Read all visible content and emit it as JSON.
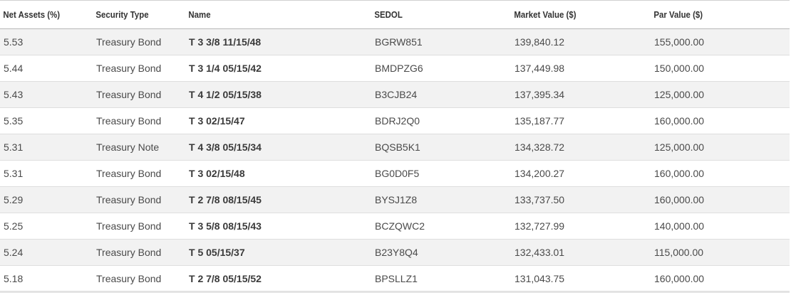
{
  "table": {
    "headers": {
      "net_assets": "Net Assets (%)",
      "security_type": "Security Type",
      "name": "Name",
      "sedol": "SEDOL",
      "market_value": "Market Value ($)",
      "par_value": "Par Value ($)"
    },
    "rows": [
      {
        "net_assets": "5.53",
        "security_type": "Treasury Bond",
        "name": "T 3 3/8 11/15/48",
        "sedol": "BGRW851",
        "market_value": "139,840.12",
        "par_value": "155,000.00"
      },
      {
        "net_assets": "5.44",
        "security_type": "Treasury Bond",
        "name": "T 3 1/4 05/15/42",
        "sedol": "BMDPZG6",
        "market_value": "137,449.98",
        "par_value": "150,000.00"
      },
      {
        "net_assets": "5.43",
        "security_type": "Treasury Bond",
        "name": "T 4 1/2 05/15/38",
        "sedol": "B3CJB24",
        "market_value": "137,395.34",
        "par_value": "125,000.00"
      },
      {
        "net_assets": "5.35",
        "security_type": "Treasury Bond",
        "name": "T 3 02/15/47",
        "sedol": "BDRJ2Q0",
        "market_value": "135,187.77",
        "par_value": "160,000.00"
      },
      {
        "net_assets": "5.31",
        "security_type": "Treasury Note",
        "name": "T 4 3/8 05/15/34",
        "sedol": "BQSB5K1",
        "market_value": "134,328.72",
        "par_value": "125,000.00"
      },
      {
        "net_assets": "5.31",
        "security_type": "Treasury Bond",
        "name": "T 3 02/15/48",
        "sedol": "BG0D0F5",
        "market_value": "134,200.27",
        "par_value": "160,000.00"
      },
      {
        "net_assets": "5.29",
        "security_type": "Treasury Bond",
        "name": "T 2 7/8 08/15/45",
        "sedol": "BYSJ1Z8",
        "market_value": "133,737.50",
        "par_value": "160,000.00"
      },
      {
        "net_assets": "5.25",
        "security_type": "Treasury Bond",
        "name": "T 3 5/8 08/15/43",
        "sedol": "BCZQWC2",
        "market_value": "132,727.99",
        "par_value": "140,000.00"
      },
      {
        "net_assets": "5.24",
        "security_type": "Treasury Bond",
        "name": "T 5 05/15/37",
        "sedol": "B23Y8Q4",
        "market_value": "132,433.01",
        "par_value": "115,000.00"
      },
      {
        "net_assets": "5.18",
        "security_type": "Treasury Bond",
        "name": "T 2 7/8 05/15/52",
        "sedol": "BPSLLZ1",
        "market_value": "131,043.75",
        "par_value": "160,000.00"
      }
    ]
  }
}
